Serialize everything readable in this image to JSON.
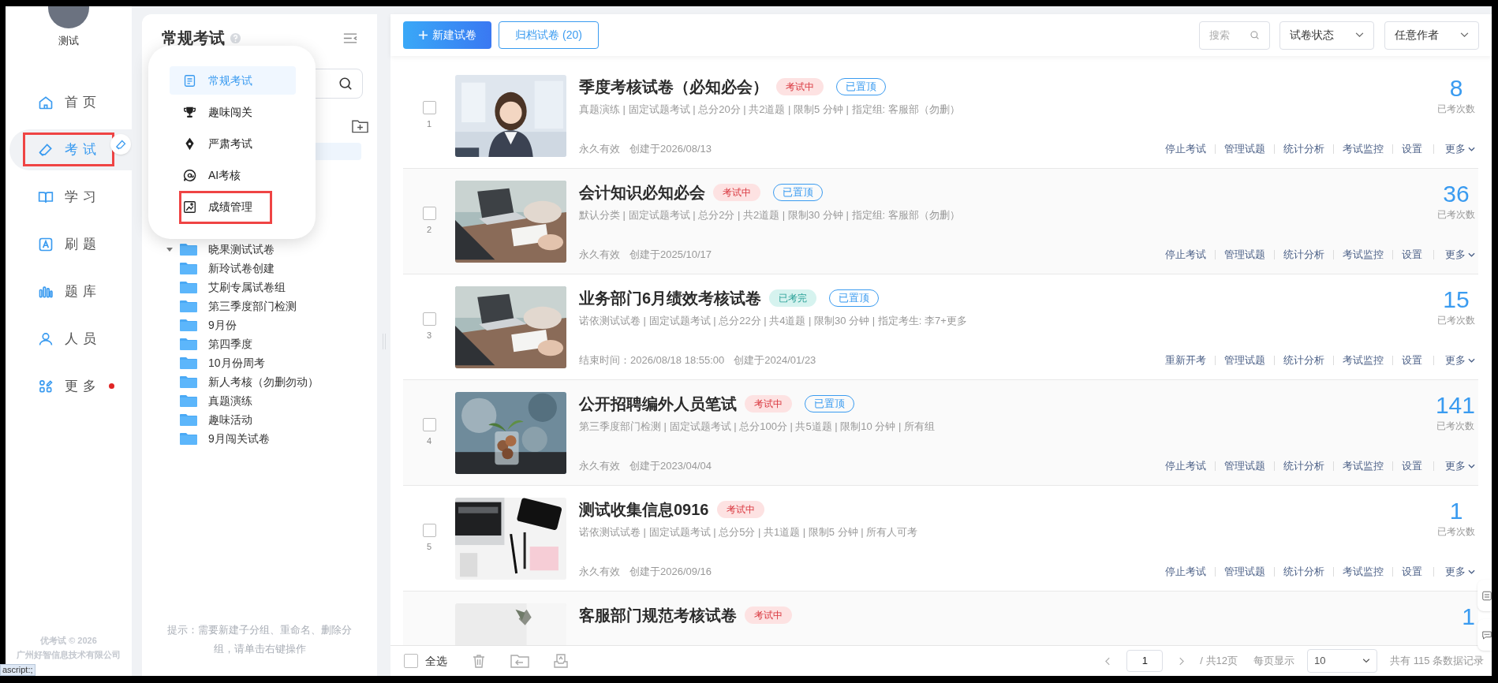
{
  "nav": {
    "user": "测试",
    "items": [
      {
        "label": "首页",
        "selected": false,
        "highlighted": false,
        "dot": false
      },
      {
        "label": "考试",
        "selected": true,
        "highlighted": true,
        "dot": false
      },
      {
        "label": "学习",
        "selected": false,
        "highlighted": false,
        "dot": false
      },
      {
        "label": "刷题",
        "selected": false,
        "highlighted": false,
        "dot": false
      },
      {
        "label": "题库",
        "selected": false,
        "highlighted": false,
        "dot": false
      },
      {
        "label": "人员",
        "selected": false,
        "highlighted": false,
        "dot": false
      },
      {
        "label": "更多",
        "selected": false,
        "highlighted": false,
        "dot": true
      }
    ],
    "copyright": "优考试 © 2026",
    "company": "广州好智信息技术有限公司"
  },
  "status_link": "ascript:;",
  "tree_panel": {
    "title": "常规考试",
    "items": [
      {
        "label": "晓果测试试卷",
        "kind": "parent"
      },
      {
        "label": "新玲试卷创建",
        "kind": "leaf"
      },
      {
        "label": "艾刷专属试卷组",
        "kind": "leaf"
      },
      {
        "label": "第三季度部门检测",
        "kind": "leaf"
      },
      {
        "label": "9月份",
        "kind": "leaf"
      },
      {
        "label": "第四季度",
        "kind": "leaf"
      },
      {
        "label": "10月份周考",
        "kind": "leaf"
      },
      {
        "label": "新人考核（勿删勿动）",
        "kind": "leaf"
      },
      {
        "label": "真题演练",
        "kind": "leaf"
      },
      {
        "label": "趣味活动",
        "kind": "leaf"
      },
      {
        "label": "9月闯关试卷",
        "kind": "leaf"
      }
    ],
    "hint": "提示：需要新建子分组、重命名、删除分组，请单击右键操作"
  },
  "exam_menu": [
    {
      "label": "常规考试",
      "selected": true,
      "highlighted": false
    },
    {
      "label": "趣味闯关",
      "selected": false,
      "highlighted": false
    },
    {
      "label": "严肃考试",
      "selected": false,
      "highlighted": false
    },
    {
      "label": "AI考核",
      "selected": false,
      "highlighted": false
    },
    {
      "label": "成绩管理",
      "selected": false,
      "highlighted": true
    }
  ],
  "toolbar": {
    "new_button": "新建试卷",
    "archive_button": "归档试卷 (20)",
    "search": {
      "placeholder": "搜索"
    },
    "filters": [
      "试卷状态",
      "任意作者"
    ]
  },
  "exams": [
    {
      "number": "1",
      "checked": false,
      "title": "季度考核试卷（必知必会）",
      "status": {
        "label": "考试中",
        "kind": "running"
      },
      "pinned": "已置顶",
      "meta": "真题演练 | 固定试题考试 | 总分20分 | 共2道题 | 限制5 分钟 | 指定组: 客服部（勿删）",
      "validity": "永久有效",
      "created": "创建于2026/08/13",
      "count": "8",
      "count_label": "已考次数",
      "actions": [
        "停止考试",
        "管理试题",
        "统计分析",
        "考试监控",
        "设置"
      ],
      "more": "更多"
    },
    {
      "number": "2",
      "checked": false,
      "title": "会计知识必知必会",
      "status": {
        "label": "考试中",
        "kind": "running"
      },
      "pinned": "已置顶",
      "meta": "默认分类 | 固定试题考试 | 总分2分 | 共2道题 | 限制30 分钟 | 指定组: 客服部（勿删）",
      "validity": "永久有效",
      "created": "创建于2025/10/17",
      "count": "36",
      "count_label": "已考次数",
      "actions": [
        "停止考试",
        "管理试题",
        "统计分析",
        "考试监控",
        "设置"
      ],
      "more": "更多"
    },
    {
      "number": "3",
      "checked": false,
      "title": "业务部门6月绩效考核试卷",
      "status": {
        "label": "已考完",
        "kind": "finished"
      },
      "pinned": "已置顶",
      "meta": "诺依测试试卷 | 固定试题考试 | 总分22分 | 共4道题 | 限制30 分钟 | 指定考生: 李7+更多",
      "validity": "结束时间：2026/08/18 18:55:00",
      "created": "创建于2024/01/23",
      "count": "15",
      "count_label": "已考次数",
      "actions": [
        "重新开考",
        "管理试题",
        "统计分析",
        "考试监控",
        "设置"
      ],
      "more": "更多"
    },
    {
      "number": "4",
      "checked": false,
      "title": "公开招聘编外人员笔试",
      "status": {
        "label": "考试中",
        "kind": "running"
      },
      "pinned": "已置顶",
      "meta": "第三季度部门检测 | 固定试题考试 | 总分100分 | 共5道题 | 限制10 分钟 | 所有组",
      "validity": "永久有效",
      "created": "创建于2023/04/04",
      "count": "141",
      "count_label": "已考次数",
      "actions": [
        "停止考试",
        "管理试题",
        "统计分析",
        "考试监控",
        "设置"
      ],
      "more": "更多"
    },
    {
      "number": "5",
      "checked": false,
      "title": "测试收集信息0916",
      "status": {
        "label": "考试中",
        "kind": "running"
      },
      "meta": "诺依测试试卷 | 固定试题考试 | 总分5分 | 共1道题 | 限制5 分钟 | 所有人可考",
      "validity": "永久有效",
      "created": "创建于2026/09/16",
      "count": "1",
      "count_label": "已考次数",
      "actions": [
        "停止考试",
        "管理试题",
        "统计分析",
        "考试监控",
        "设置"
      ],
      "more": "更多"
    },
    {
      "title": "客服部门规范考核试卷",
      "status": {
        "label": "考试中",
        "kind": "running"
      },
      "count": "1"
    }
  ],
  "footer": {
    "select_all": "全选",
    "select_all_checked": false,
    "page": "1",
    "total_pages": "/ 共12页",
    "per_page_label": "每页显示",
    "per_page": "10",
    "total": "共有 115 条数据记录"
  }
}
